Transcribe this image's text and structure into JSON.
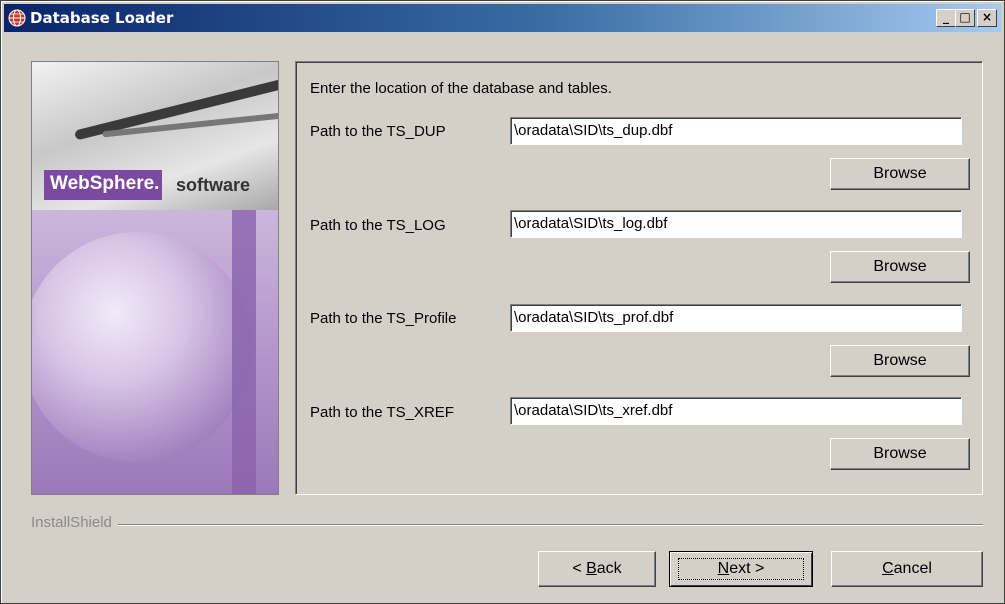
{
  "window": {
    "title": "Database Loader",
    "icon": "globe-icon",
    "controls": {
      "minimize": "_",
      "maximize": "□",
      "close": "×"
    }
  },
  "banner": {
    "brand": "WebSphere.",
    "product": "software"
  },
  "form": {
    "instructions": "Enter the location of the database and tables.",
    "fields": [
      {
        "label": "Path to the TS_DUP",
        "value": "\\oradata\\SID\\ts_dup.dbf",
        "browse_label": "Browse"
      },
      {
        "label": "Path to the TS_LOG",
        "value": "\\oradata\\SID\\ts_log.dbf",
        "browse_label": "Browse"
      },
      {
        "label": "Path to the TS_Profile",
        "value": "\\oradata\\SID\\ts_prof.dbf",
        "browse_label": "Browse"
      },
      {
        "label": "Path to the TS_XREF",
        "value": "\\oradata\\SID\\ts_xref.dbf",
        "browse_label": "Browse"
      }
    ]
  },
  "footer": {
    "vendor": "InstallShield",
    "back": {
      "prefix": "< ",
      "mnemonic": "B",
      "rest": "ack"
    },
    "next": {
      "mnemonic": "N",
      "rest": "ext >"
    },
    "cancel": {
      "mnemonic": "C",
      "rest": "ancel"
    }
  },
  "colors": {
    "titlebar_start": "#0a246a",
    "titlebar_end": "#a6caf0",
    "face": "#d4d0c8",
    "brand_purple": "#7b4aa0"
  }
}
